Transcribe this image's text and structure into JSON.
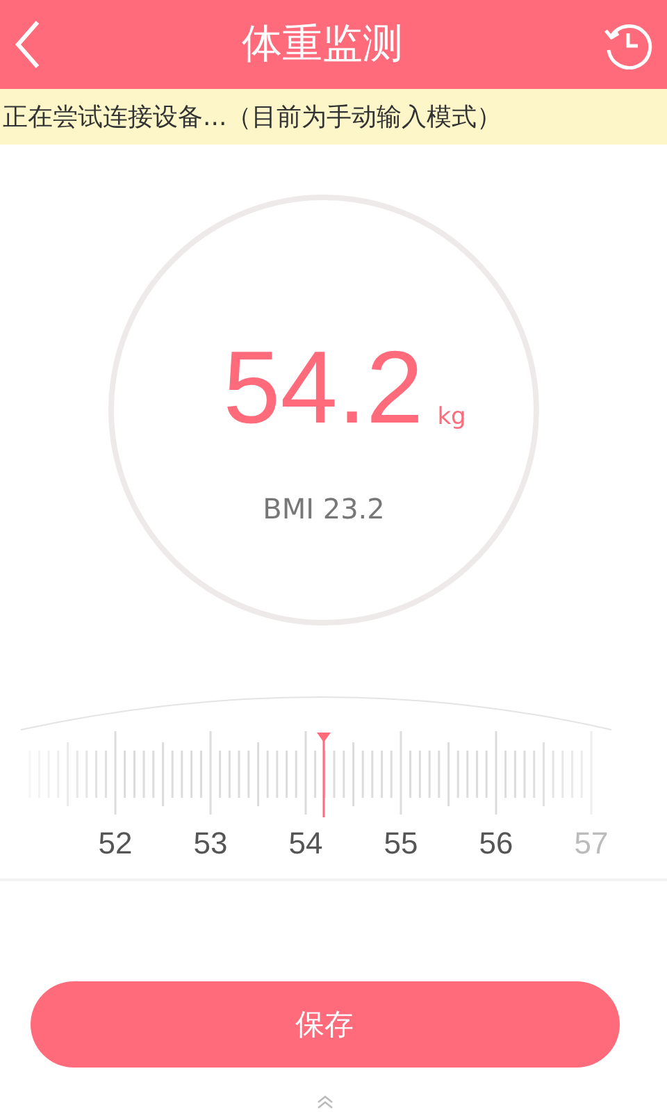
{
  "header": {
    "title": "体重监测"
  },
  "status_banner": "正在尝试连接设备...（目前为手动输入模式）",
  "reading": {
    "weight": "54.2",
    "unit": "kg",
    "bmi": "BMI 23.2"
  },
  "ruler": {
    "labels": [
      "52",
      "53",
      "54",
      "55",
      "56",
      "57"
    ]
  },
  "save_button": "保存"
}
